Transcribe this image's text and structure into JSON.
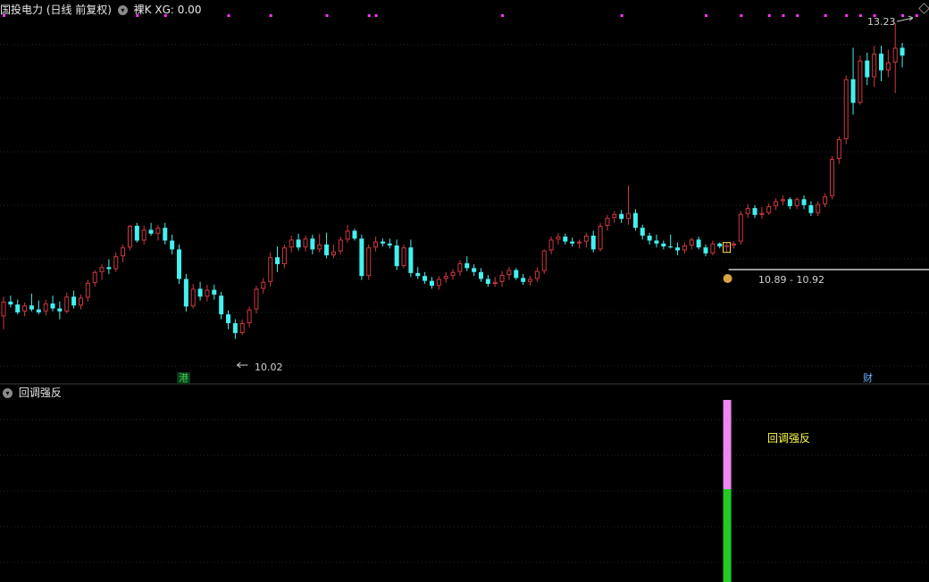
{
  "header": {
    "title": "国投电力 (日线 前复权)",
    "mode": "裸K",
    "indicator_value": "XG: 0.00"
  },
  "sub_panel": {
    "title": "回调强反"
  },
  "annotations": {
    "high_label": "13.23",
    "low_label": "10.02",
    "range_label": "10.89 - 10.92",
    "signal_label": "回调强反",
    "tag_left": "港",
    "tag_right": "财"
  },
  "colors": {
    "up": "#d0383f",
    "down": "#44f0f0",
    "signal_dots": "#ff33ff",
    "signal_pink": "#ee88ee",
    "signal_green": "#22cc22",
    "highlight_box": "#ffee44",
    "grid": "#1c2a38"
  },
  "chart_data": {
    "type": "candlestick",
    "ylim": [
      9.6,
      13.32
    ],
    "high": 13.23,
    "low": 10.02,
    "ohlc": [
      [
        10.25,
        10.45,
        10.12,
        10.4
      ],
      [
        10.4,
        10.46,
        10.34,
        10.37
      ],
      [
        10.37,
        10.42,
        10.27,
        10.29
      ],
      [
        10.3,
        10.39,
        10.25,
        10.36
      ],
      [
        10.36,
        10.48,
        10.3,
        10.32
      ],
      [
        10.32,
        10.41,
        10.27,
        10.29
      ],
      [
        10.3,
        10.42,
        10.26,
        10.38
      ],
      [
        10.38,
        10.46,
        10.3,
        10.33
      ],
      [
        10.33,
        10.4,
        10.22,
        10.3
      ],
      [
        10.3,
        10.49,
        10.28,
        10.45
      ],
      [
        10.45,
        10.51,
        10.33,
        10.36
      ],
      [
        10.36,
        10.47,
        10.32,
        10.44
      ],
      [
        10.44,
        10.62,
        10.4,
        10.59
      ],
      [
        10.59,
        10.72,
        10.55,
        10.7
      ],
      [
        10.7,
        10.78,
        10.62,
        10.75
      ],
      [
        10.75,
        10.83,
        10.68,
        10.73
      ],
      [
        10.73,
        10.9,
        10.7,
        10.86
      ],
      [
        10.86,
        10.98,
        10.8,
        10.95
      ],
      [
        10.95,
        11.18,
        10.92,
        11.17
      ],
      [
        11.17,
        11.2,
        11.0,
        11.02
      ],
      [
        11.02,
        11.17,
        10.98,
        11.13
      ],
      [
        11.13,
        11.2,
        11.07,
        11.09
      ],
      [
        11.09,
        11.18,
        11.02,
        11.15
      ],
      [
        11.15,
        11.2,
        10.98,
        11.02
      ],
      [
        11.02,
        11.08,
        10.88,
        10.93
      ],
      [
        10.93,
        10.98,
        10.58,
        10.63
      ],
      [
        10.63,
        10.68,
        10.3,
        10.35
      ],
      [
        10.35,
        10.58,
        10.33,
        10.53
      ],
      [
        10.53,
        10.6,
        10.41,
        10.45
      ],
      [
        10.45,
        10.57,
        10.4,
        10.52
      ],
      [
        10.52,
        10.57,
        10.42,
        10.47
      ],
      [
        10.46,
        10.5,
        10.22,
        10.27
      ],
      [
        10.27,
        10.31,
        10.12,
        10.18
      ],
      [
        10.18,
        10.22,
        10.02,
        10.08
      ],
      [
        10.08,
        10.22,
        10.06,
        10.18
      ],
      [
        10.18,
        10.35,
        10.14,
        10.32
      ],
      [
        10.32,
        10.56,
        10.28,
        10.53
      ],
      [
        10.53,
        10.64,
        10.48,
        10.6
      ],
      [
        10.6,
        10.9,
        10.55,
        10.85
      ],
      [
        10.85,
        10.96,
        10.7,
        10.78
      ],
      [
        10.78,
        10.98,
        10.74,
        10.95
      ],
      [
        10.95,
        11.07,
        10.9,
        11.03
      ],
      [
        11.03,
        11.09,
        10.92,
        10.95
      ],
      [
        10.95,
        11.07,
        10.91,
        11.04
      ],
      [
        11.04,
        11.08,
        10.88,
        10.93
      ],
      [
        10.93,
        11.09,
        10.9,
        10.98
      ],
      [
        10.98,
        11.1,
        10.84,
        10.87
      ],
      [
        10.87,
        10.98,
        10.84,
        10.91
      ],
      [
        10.91,
        11.06,
        10.88,
        11.03
      ],
      [
        11.03,
        11.18,
        11.0,
        11.12
      ],
      [
        11.12,
        11.14,
        11.02,
        11.04
      ],
      [
        11.04,
        11.08,
        10.62,
        10.66
      ],
      [
        10.66,
        10.98,
        10.62,
        10.95
      ],
      [
        10.95,
        11.06,
        10.91,
        11.01
      ],
      [
        11.01,
        11.04,
        10.96,
        10.99
      ],
      [
        10.99,
        11.04,
        10.94,
        10.97
      ],
      [
        10.97,
        11.03,
        10.72,
        10.76
      ],
      [
        10.76,
        10.98,
        10.74,
        10.95
      ],
      [
        10.95,
        11.03,
        10.65,
        10.69
      ],
      [
        10.69,
        10.75,
        10.63,
        10.66
      ],
      [
        10.66,
        10.7,
        10.58,
        10.61
      ],
      [
        10.61,
        10.65,
        10.53,
        10.56
      ],
      [
        10.56,
        10.66,
        10.52,
        10.63
      ],
      [
        10.63,
        10.7,
        10.59,
        10.66
      ],
      [
        10.66,
        10.73,
        10.62,
        10.7
      ],
      [
        10.7,
        10.82,
        10.66,
        10.79
      ],
      [
        10.79,
        10.86,
        10.71,
        10.74
      ],
      [
        10.74,
        10.78,
        10.66,
        10.7
      ],
      [
        10.7,
        10.74,
        10.6,
        10.63
      ],
      [
        10.63,
        10.67,
        10.55,
        10.58
      ],
      [
        10.58,
        10.65,
        10.55,
        10.6
      ],
      [
        10.6,
        10.71,
        10.55,
        10.67
      ],
      [
        10.67,
        10.75,
        10.62,
        10.72
      ],
      [
        10.72,
        10.74,
        10.62,
        10.64
      ],
      [
        10.64,
        10.68,
        10.57,
        10.6
      ],
      [
        10.6,
        10.66,
        10.56,
        10.63
      ],
      [
        10.63,
        10.75,
        10.6,
        10.71
      ],
      [
        10.71,
        10.93,
        10.68,
        10.92
      ],
      [
        10.92,
        11.06,
        10.88,
        11.03
      ],
      [
        11.03,
        11.1,
        10.98,
        11.06
      ],
      [
        11.06,
        11.09,
        10.98,
        11.01
      ],
      [
        11.01,
        11.05,
        10.96,
        10.99
      ],
      [
        10.99,
        11.03,
        10.94,
        11.01
      ],
      [
        11.01,
        11.1,
        10.95,
        11.07
      ],
      [
        11.07,
        11.12,
        10.9,
        10.93
      ],
      [
        10.93,
        11.2,
        10.91,
        11.17
      ],
      [
        11.17,
        11.28,
        11.12,
        11.25
      ],
      [
        11.25,
        11.32,
        11.2,
        11.29
      ],
      [
        11.29,
        11.33,
        11.2,
        11.24
      ],
      [
        11.24,
        11.58,
        11.18,
        11.3
      ],
      [
        11.3,
        11.34,
        11.12,
        11.15
      ],
      [
        11.15,
        11.18,
        11.03,
        11.07
      ],
      [
        11.07,
        11.1,
        10.98,
        11.02
      ],
      [
        11.02,
        11.08,
        10.95,
        10.99
      ],
      [
        10.99,
        11.02,
        10.93,
        10.96
      ],
      [
        10.96,
        11.08,
        10.94,
        10.95
      ],
      [
        10.95,
        11.0,
        10.87,
        10.92
      ],
      [
        10.92,
        11.0,
        10.89,
        10.97
      ],
      [
        10.97,
        11.05,
        10.93,
        11.03
      ],
      [
        11.03,
        11.06,
        10.93,
        10.95
      ],
      [
        10.95,
        10.98,
        10.86,
        10.89
      ],
      [
        10.89,
        11.02,
        10.87,
        10.99
      ],
      [
        10.99,
        11.0,
        10.94,
        10.96
      ],
      [
        10.96,
        11.0,
        10.9,
        10.97
      ],
      [
        10.97,
        11.01,
        10.94,
        10.99
      ],
      [
        11.01,
        11.32,
        10.98,
        11.29
      ],
      [
        11.29,
        11.39,
        11.25,
        11.35
      ],
      [
        11.35,
        11.38,
        11.25,
        11.28
      ],
      [
        11.28,
        11.36,
        11.24,
        11.3
      ],
      [
        11.3,
        11.4,
        11.28,
        11.37
      ],
      [
        11.37,
        11.45,
        11.33,
        11.42
      ],
      [
        11.42,
        11.48,
        11.38,
        11.44
      ],
      [
        11.44,
        11.46,
        11.34,
        11.37
      ],
      [
        11.37,
        11.46,
        11.34,
        11.44
      ],
      [
        11.44,
        11.48,
        11.34,
        11.38
      ],
      [
        11.38,
        11.42,
        11.27,
        11.3
      ],
      [
        11.3,
        11.42,
        11.27,
        11.39
      ],
      [
        11.39,
        11.5,
        11.36,
        11.47
      ],
      [
        11.47,
        11.88,
        11.44,
        11.85
      ],
      [
        11.85,
        12.08,
        11.8,
        12.05
      ],
      [
        12.05,
        12.7,
        12.0,
        12.66
      ],
      [
        12.66,
        12.98,
        12.3,
        12.42
      ],
      [
        12.42,
        12.9,
        12.4,
        12.85
      ],
      [
        12.85,
        12.93,
        12.6,
        12.68
      ],
      [
        12.68,
        13.0,
        12.58,
        12.92
      ],
      [
        12.92,
        13.0,
        12.64,
        12.75
      ],
      [
        12.75,
        12.96,
        12.68,
        12.83
      ],
      [
        12.83,
        13.23,
        12.52,
        12.98
      ],
      [
        12.98,
        13.03,
        12.78,
        12.9
      ]
    ],
    "signal_dots_idx": [
      0,
      19,
      23,
      32,
      38,
      46,
      52,
      53,
      71,
      88,
      100,
      105,
      109,
      111,
      113,
      117,
      120,
      122,
      124,
      128,
      130,
      132
    ],
    "signal_bar_idx": 103
  }
}
